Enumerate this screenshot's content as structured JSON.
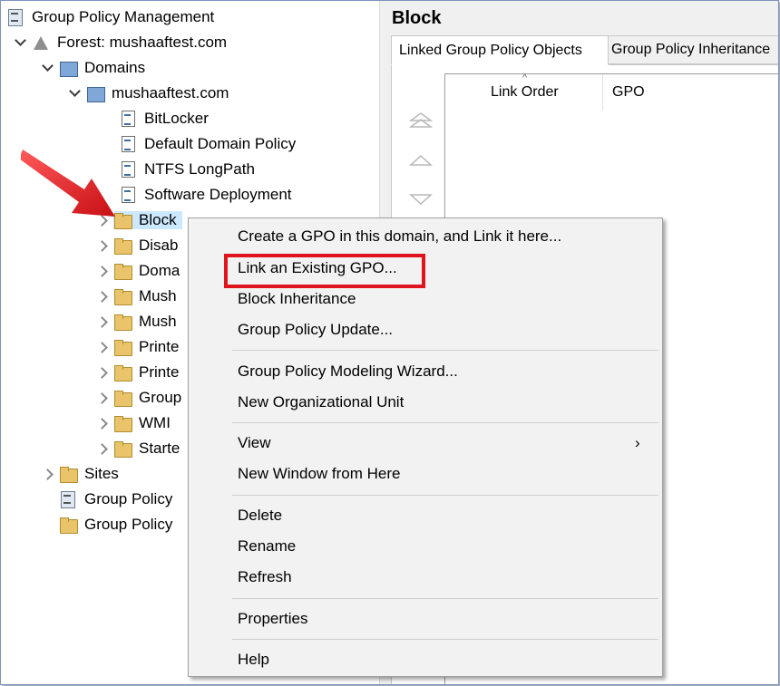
{
  "tree": {
    "root": "Group Policy Management",
    "forest": "Forest: mushaaftest.com",
    "domains": "Domains",
    "domain": "mushaaftest.com",
    "gpos": [
      "BitLocker",
      "Default Domain Policy",
      "NTFS LongPath",
      "Software Deployment"
    ],
    "ous": [
      "Block",
      "Disab",
      "Doma",
      "Mush",
      "Mush",
      "Printe",
      "Printe",
      "Group",
      "WMI",
      "Starte"
    ],
    "sites": "Sites",
    "modeling": "Group Policy",
    "results": "Group Policy"
  },
  "right_pane": {
    "title": "Block",
    "tabs": [
      "Linked Group Policy Objects",
      "Group Policy Inheritance"
    ],
    "columns": [
      "Link Order",
      "GPO"
    ]
  },
  "context_menu": {
    "items": [
      "Create a GPO in this domain, and Link it here...",
      "Link an Existing GPO...",
      "Block Inheritance",
      "Group Policy Update...",
      "Group Policy Modeling Wizard...",
      "New Organizational Unit",
      "View",
      "New Window from Here",
      "Delete",
      "Rename",
      "Refresh",
      "Properties",
      "Help"
    ],
    "highlighted": "Link an Existing GPO..."
  },
  "colors": {
    "highlight_box": "#e0141c",
    "arrow": "#e0141c",
    "selection": "#cce8ff"
  }
}
